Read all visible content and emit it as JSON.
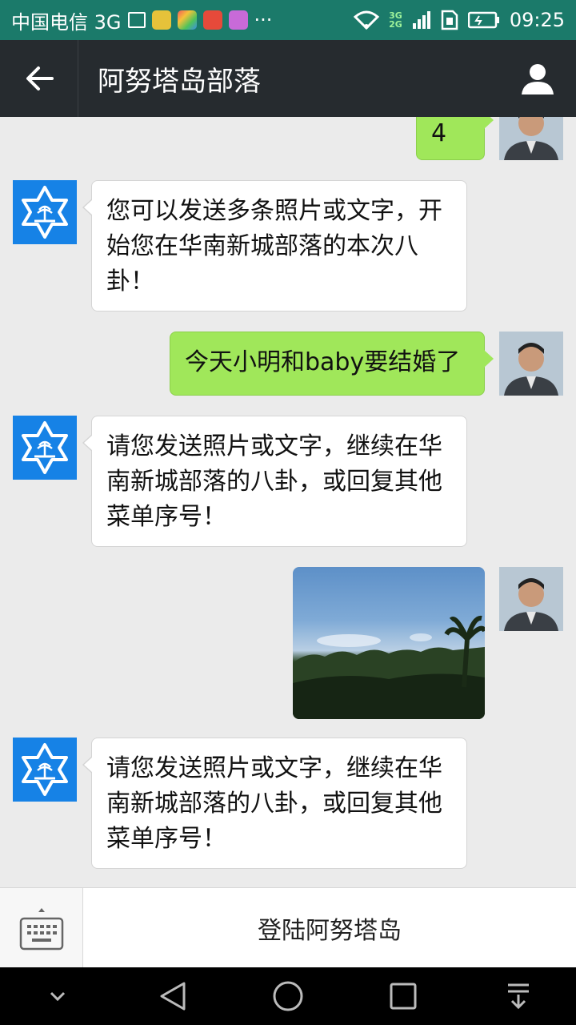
{
  "status_bar": {
    "carrier": "中国电信 3G",
    "network_small_top": "3G",
    "network_small_bottom": "2G",
    "more": "···",
    "time": "09:25"
  },
  "header": {
    "title": "阿努塔岛部落"
  },
  "messages": [
    {
      "id": "m0",
      "side": "out",
      "text": "4"
    },
    {
      "id": "m1",
      "side": "in",
      "text": "您可以发送多条照片或文字，开始您在华南新城部落的本次八卦！"
    },
    {
      "id": "m2",
      "side": "out",
      "text": "今天小明和baby要结婚了"
    },
    {
      "id": "m3",
      "side": "in",
      "text": "请您发送照片或文字，继续在华南新城部落的八卦，或回复其他菜单序号！"
    },
    {
      "id": "m4",
      "side": "out",
      "type": "image"
    },
    {
      "id": "m5",
      "side": "in",
      "text": "请您发送照片或文字，继续在华南新城部落的八卦，或回复其他菜单序号！"
    }
  ],
  "bottom_bar": {
    "menu_label": "登陆阿努塔岛"
  },
  "colors": {
    "status_bar": "#1b7a6a",
    "title_bar": "#262b2f",
    "chat_bg": "#ebebeb",
    "bubble_out": "#a0e75a",
    "bubble_in": "#ffffff",
    "bot_avatar": "#1682e6"
  },
  "icons": {
    "back": "arrow-left-icon",
    "profile": "person-icon",
    "keyboard": "keyboard-icon",
    "nav_down": "chevron-down-icon",
    "nav_back": "triangle-back-icon",
    "nav_home": "circle-home-icon",
    "nav_recents": "square-recents-icon",
    "nav_notifications": "pull-down-icon"
  }
}
